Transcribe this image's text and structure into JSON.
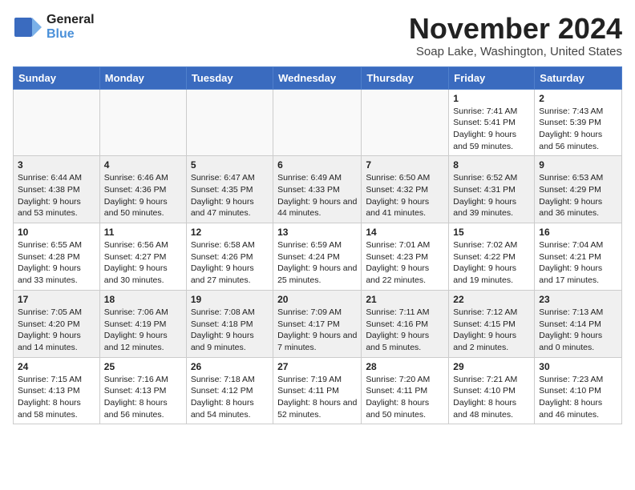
{
  "logo": {
    "line1": "General",
    "line2": "Blue"
  },
  "title": "November 2024",
  "location": "Soap Lake, Washington, United States",
  "days_of_week": [
    "Sunday",
    "Monday",
    "Tuesday",
    "Wednesday",
    "Thursday",
    "Friday",
    "Saturday"
  ],
  "weeks": [
    [
      {
        "day": "",
        "info": ""
      },
      {
        "day": "",
        "info": ""
      },
      {
        "day": "",
        "info": ""
      },
      {
        "day": "",
        "info": ""
      },
      {
        "day": "",
        "info": ""
      },
      {
        "day": "1",
        "info": "Sunrise: 7:41 AM\nSunset: 5:41 PM\nDaylight: 9 hours and 59 minutes."
      },
      {
        "day": "2",
        "info": "Sunrise: 7:43 AM\nSunset: 5:39 PM\nDaylight: 9 hours and 56 minutes."
      }
    ],
    [
      {
        "day": "3",
        "info": "Sunrise: 6:44 AM\nSunset: 4:38 PM\nDaylight: 9 hours and 53 minutes."
      },
      {
        "day": "4",
        "info": "Sunrise: 6:46 AM\nSunset: 4:36 PM\nDaylight: 9 hours and 50 minutes."
      },
      {
        "day": "5",
        "info": "Sunrise: 6:47 AM\nSunset: 4:35 PM\nDaylight: 9 hours and 47 minutes."
      },
      {
        "day": "6",
        "info": "Sunrise: 6:49 AM\nSunset: 4:33 PM\nDaylight: 9 hours and 44 minutes."
      },
      {
        "day": "7",
        "info": "Sunrise: 6:50 AM\nSunset: 4:32 PM\nDaylight: 9 hours and 41 minutes."
      },
      {
        "day": "8",
        "info": "Sunrise: 6:52 AM\nSunset: 4:31 PM\nDaylight: 9 hours and 39 minutes."
      },
      {
        "day": "9",
        "info": "Sunrise: 6:53 AM\nSunset: 4:29 PM\nDaylight: 9 hours and 36 minutes."
      }
    ],
    [
      {
        "day": "10",
        "info": "Sunrise: 6:55 AM\nSunset: 4:28 PM\nDaylight: 9 hours and 33 minutes."
      },
      {
        "day": "11",
        "info": "Sunrise: 6:56 AM\nSunset: 4:27 PM\nDaylight: 9 hours and 30 minutes."
      },
      {
        "day": "12",
        "info": "Sunrise: 6:58 AM\nSunset: 4:26 PM\nDaylight: 9 hours and 27 minutes."
      },
      {
        "day": "13",
        "info": "Sunrise: 6:59 AM\nSunset: 4:24 PM\nDaylight: 9 hours and 25 minutes."
      },
      {
        "day": "14",
        "info": "Sunrise: 7:01 AM\nSunset: 4:23 PM\nDaylight: 9 hours and 22 minutes."
      },
      {
        "day": "15",
        "info": "Sunrise: 7:02 AM\nSunset: 4:22 PM\nDaylight: 9 hours and 19 minutes."
      },
      {
        "day": "16",
        "info": "Sunrise: 7:04 AM\nSunset: 4:21 PM\nDaylight: 9 hours and 17 minutes."
      }
    ],
    [
      {
        "day": "17",
        "info": "Sunrise: 7:05 AM\nSunset: 4:20 PM\nDaylight: 9 hours and 14 minutes."
      },
      {
        "day": "18",
        "info": "Sunrise: 7:06 AM\nSunset: 4:19 PM\nDaylight: 9 hours and 12 minutes."
      },
      {
        "day": "19",
        "info": "Sunrise: 7:08 AM\nSunset: 4:18 PM\nDaylight: 9 hours and 9 minutes."
      },
      {
        "day": "20",
        "info": "Sunrise: 7:09 AM\nSunset: 4:17 PM\nDaylight: 9 hours and 7 minutes."
      },
      {
        "day": "21",
        "info": "Sunrise: 7:11 AM\nSunset: 4:16 PM\nDaylight: 9 hours and 5 minutes."
      },
      {
        "day": "22",
        "info": "Sunrise: 7:12 AM\nSunset: 4:15 PM\nDaylight: 9 hours and 2 minutes."
      },
      {
        "day": "23",
        "info": "Sunrise: 7:13 AM\nSunset: 4:14 PM\nDaylight: 9 hours and 0 minutes."
      }
    ],
    [
      {
        "day": "24",
        "info": "Sunrise: 7:15 AM\nSunset: 4:13 PM\nDaylight: 8 hours and 58 minutes."
      },
      {
        "day": "25",
        "info": "Sunrise: 7:16 AM\nSunset: 4:13 PM\nDaylight: 8 hours and 56 minutes."
      },
      {
        "day": "26",
        "info": "Sunrise: 7:18 AM\nSunset: 4:12 PM\nDaylight: 8 hours and 54 minutes."
      },
      {
        "day": "27",
        "info": "Sunrise: 7:19 AM\nSunset: 4:11 PM\nDaylight: 8 hours and 52 minutes."
      },
      {
        "day": "28",
        "info": "Sunrise: 7:20 AM\nSunset: 4:11 PM\nDaylight: 8 hours and 50 minutes."
      },
      {
        "day": "29",
        "info": "Sunrise: 7:21 AM\nSunset: 4:10 PM\nDaylight: 8 hours and 48 minutes."
      },
      {
        "day": "30",
        "info": "Sunrise: 7:23 AM\nSunset: 4:10 PM\nDaylight: 8 hours and 46 minutes."
      }
    ]
  ]
}
